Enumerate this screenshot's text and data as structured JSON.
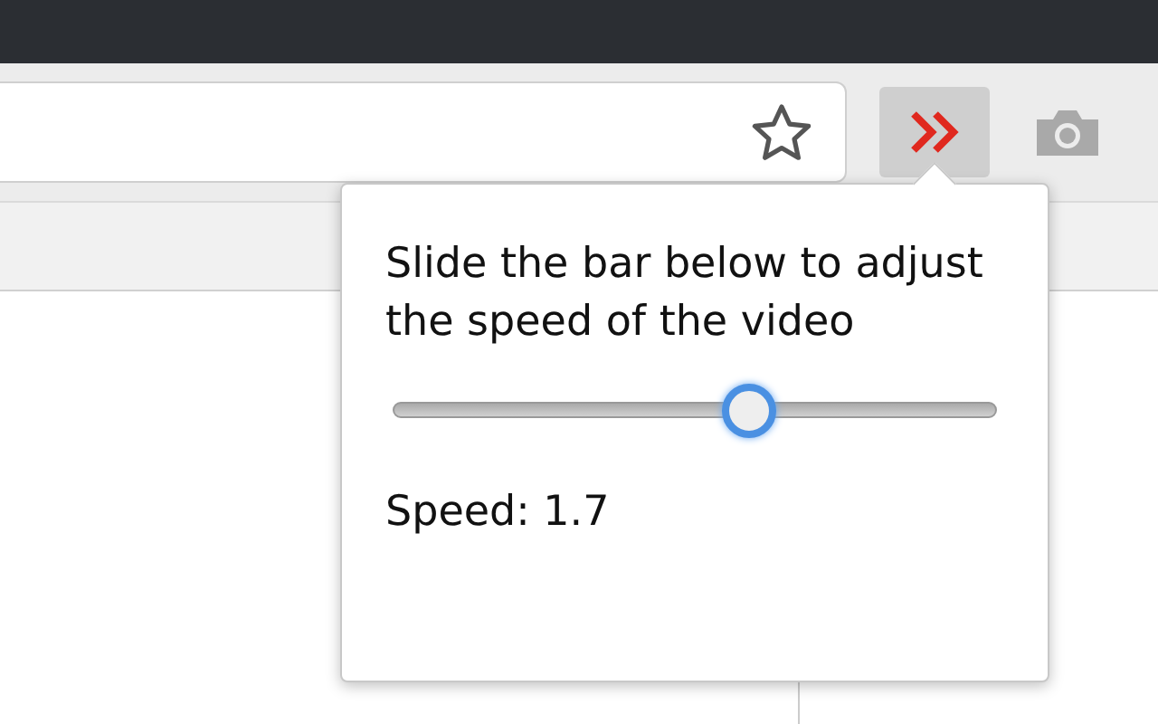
{
  "toolbar": {
    "extension_button": {
      "pressed": true
    }
  },
  "popup": {
    "instruction": "Slide the bar below to adjust the speed of the video",
    "slider": {
      "level": 0.59
    },
    "speed_label": "Speed: 1.7"
  }
}
